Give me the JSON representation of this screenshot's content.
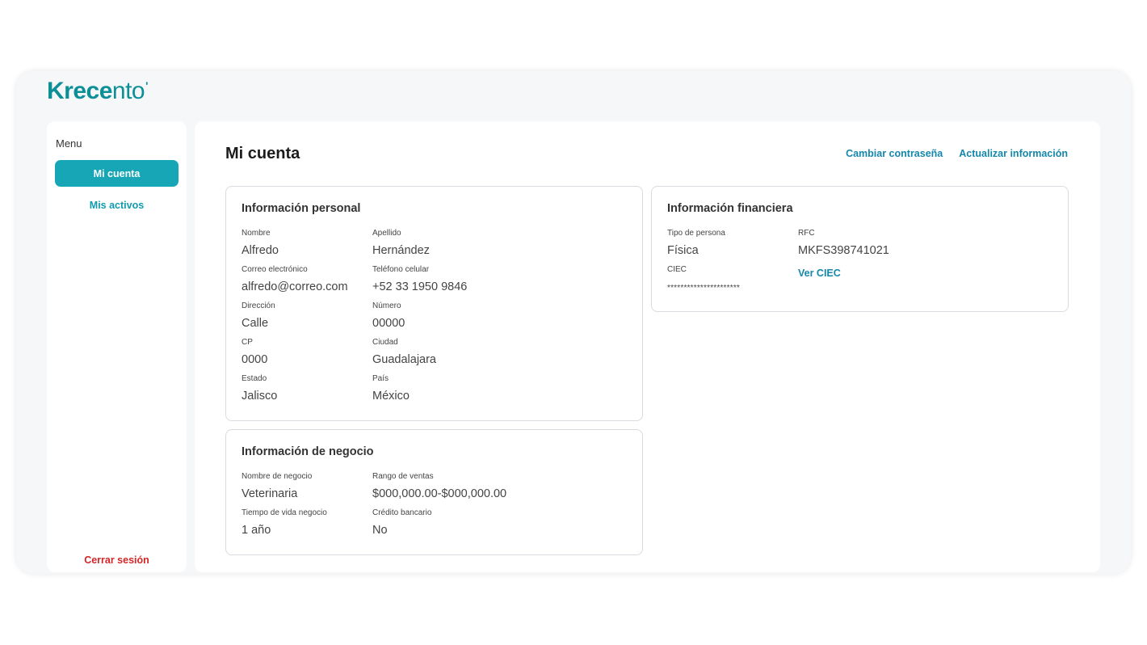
{
  "brand": {
    "logo_bold": "Krece",
    "logo_light": "nto",
    "logo_mark": "'"
  },
  "sidebar": {
    "menu_label": "Menu",
    "items": [
      {
        "label": "Mi cuenta",
        "active": true
      },
      {
        "label": "Mis activos",
        "active": false
      }
    ],
    "logout_label": "Cerrar sesión"
  },
  "header": {
    "title": "Mi cuenta",
    "change_password_label": "Cambiar contraseña",
    "update_info_label": "Actualizar información"
  },
  "personal": {
    "title": "Información personal",
    "fields": [
      {
        "label": "Nombre",
        "value": "Alfredo"
      },
      {
        "label": "Apellido",
        "value": "Hernández"
      },
      {
        "label": "Correo electrónico",
        "value": "alfredo@correo.com"
      },
      {
        "label": "Teléfono celular",
        "value": "+52 33 1950 9846"
      },
      {
        "label": "Dirección",
        "value": "Calle"
      },
      {
        "label": "Número",
        "value": "00000"
      },
      {
        "label": "CP",
        "value": "0000"
      },
      {
        "label": "Ciudad",
        "value": "Guadalajara"
      },
      {
        "label": "Estado",
        "value": "Jalisco"
      },
      {
        "label": "País",
        "value": "México"
      }
    ]
  },
  "business": {
    "title": "Información de negocio",
    "fields": [
      {
        "label": "Nombre de negocio",
        "value": "Veterinaria"
      },
      {
        "label": "Rango de ventas",
        "value": "$000,000.00-$000,000.00"
      },
      {
        "label": "Tiempo de vida negocio",
        "value": "1 año"
      },
      {
        "label": "Crédito bancario",
        "value": "No"
      }
    ]
  },
  "financial": {
    "title": "Información financiera",
    "fields": [
      {
        "label": "Tipo de persona",
        "value": "Física"
      },
      {
        "label": "RFC",
        "value": "MKFS398741021"
      },
      {
        "label": "CIEC",
        "value": "**********************"
      }
    ],
    "view_ciec_label": "Ver CIEC"
  },
  "colors": {
    "accent": "#16a6b6",
    "link": "#1587aa",
    "logout": "#d42626",
    "brand": "#0d8f98"
  }
}
